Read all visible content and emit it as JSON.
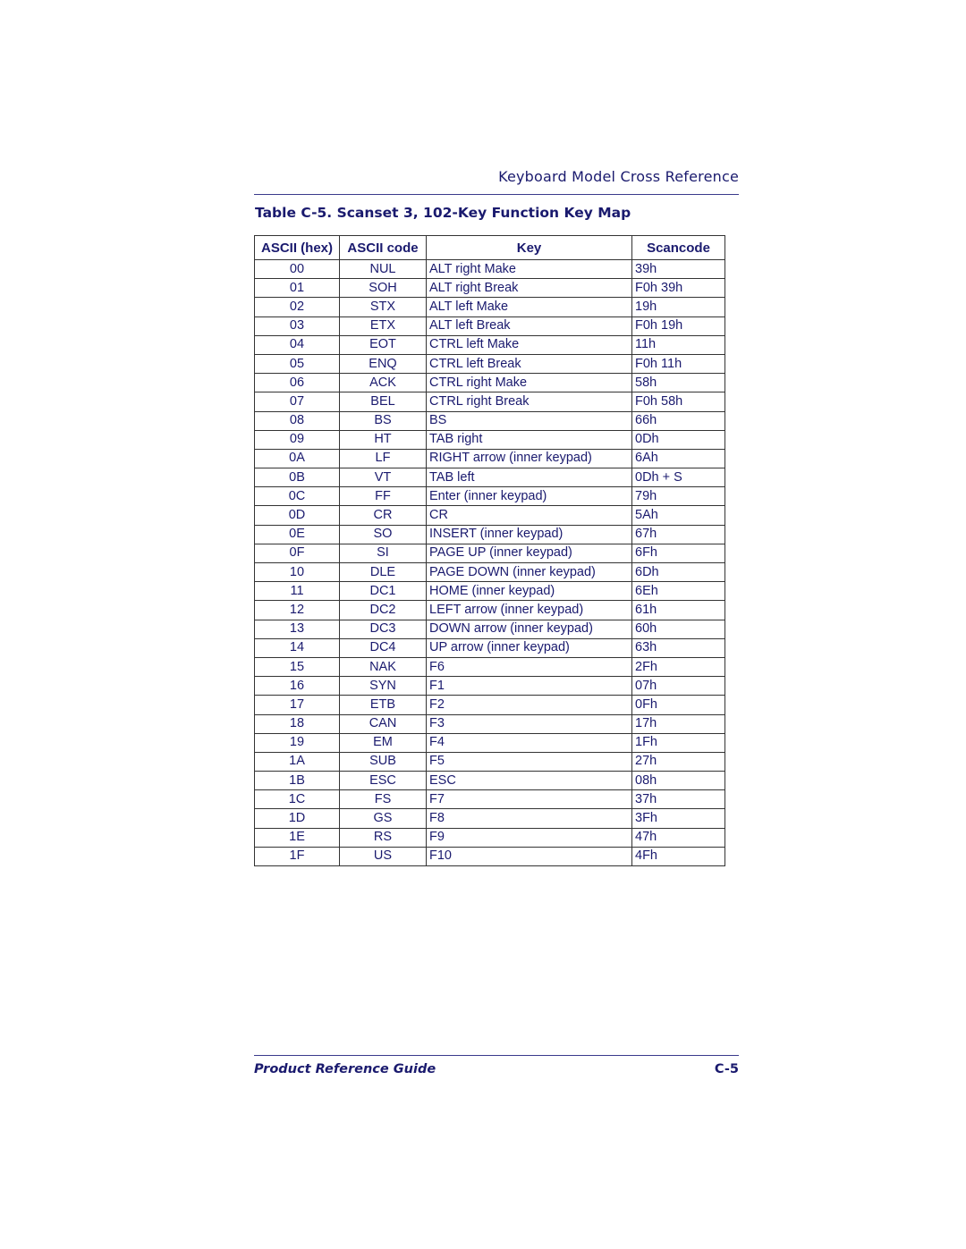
{
  "header": {
    "running_head": "Keyboard Model Cross Reference"
  },
  "table": {
    "title": "Table C-5. Scanset 3, 102-Key Function Key Map",
    "columns": [
      "ASCII (hex)",
      "ASCII code",
      "Key",
      "Scancode"
    ],
    "rows": [
      [
        "00",
        "NUL",
        "ALT right Make",
        "39h"
      ],
      [
        "01",
        "SOH",
        "ALT right Break",
        "F0h 39h"
      ],
      [
        "02",
        "STX",
        "ALT left Make",
        "19h"
      ],
      [
        "03",
        "ETX",
        "ALT left Break",
        "F0h 19h"
      ],
      [
        "04",
        "EOT",
        "CTRL left Make",
        "11h"
      ],
      [
        "05",
        "ENQ",
        "CTRL left Break",
        "F0h 11h"
      ],
      [
        "06",
        "ACK",
        "CTRL right Make",
        "58h"
      ],
      [
        "07",
        "BEL",
        "CTRL right Break",
        "F0h 58h"
      ],
      [
        "08",
        "BS",
        "BS",
        "66h"
      ],
      [
        "09",
        "HT",
        "TAB right",
        "0Dh"
      ],
      [
        "0A",
        "LF",
        "RIGHT arrow (inner keypad)",
        "6Ah"
      ],
      [
        "0B",
        "VT",
        "TAB left",
        "0Dh + S"
      ],
      [
        "0C",
        "FF",
        "Enter (inner keypad)",
        "79h"
      ],
      [
        "0D",
        "CR",
        "CR",
        "5Ah"
      ],
      [
        "0E",
        "SO",
        "INSERT (inner keypad)",
        "67h"
      ],
      [
        "0F",
        "SI",
        "PAGE UP (inner keypad)",
        "6Fh"
      ],
      [
        "10",
        "DLE",
        "PAGE DOWN (inner keypad)",
        "6Dh"
      ],
      [
        "11",
        "DC1",
        "HOME (inner keypad)",
        "6Eh"
      ],
      [
        "12",
        "DC2",
        "LEFT arrow (inner keypad)",
        "61h"
      ],
      [
        "13",
        "DC3",
        "DOWN arrow (inner keypad)",
        "60h"
      ],
      [
        "14",
        "DC4",
        "UP arrow (inner keypad)",
        "63h"
      ],
      [
        "15",
        "NAK",
        "F6",
        "2Fh"
      ],
      [
        "16",
        "SYN",
        "F1",
        "07h"
      ],
      [
        "17",
        "ETB",
        "F2",
        "0Fh"
      ],
      [
        "18",
        "CAN",
        "F3",
        "17h"
      ],
      [
        "19",
        "EM",
        "F4",
        "1Fh"
      ],
      [
        "1A",
        "SUB",
        "F5",
        "27h"
      ],
      [
        "1B",
        "ESC",
        "ESC",
        "08h"
      ],
      [
        "1C",
        "FS",
        "F7",
        "37h"
      ],
      [
        "1D",
        "GS",
        "F8",
        "3Fh"
      ],
      [
        "1E",
        "RS",
        "F9",
        "47h"
      ],
      [
        "1F",
        "US",
        "F10",
        "4Fh"
      ]
    ]
  },
  "footer": {
    "guide_title": "Product Reference Guide",
    "page_number": "C-5"
  },
  "colors": {
    "text": "#1a1a6e",
    "rule": "#3a3a8c",
    "table_border": "#333333"
  }
}
